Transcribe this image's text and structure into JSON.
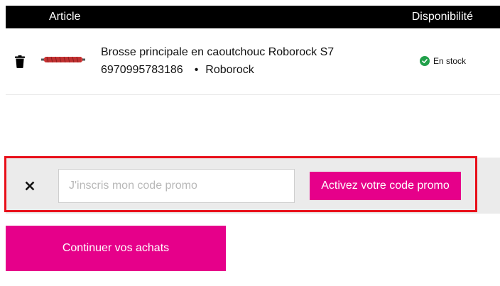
{
  "table_header": {
    "article_label": "Article",
    "availability_label": "Disponibilité"
  },
  "product": {
    "name": "Brosse principale en caoutchouc Roborock S7",
    "sku": "6970995783186",
    "brand": "Roborock",
    "stock_status": "En stock",
    "thumbnail_icon": "brush-thumbnail"
  },
  "icons": {
    "delete": "trash-icon",
    "stock": "check-circle-icon",
    "close": "close-icon"
  },
  "promo": {
    "placeholder": "J'inscris mon code promo",
    "value": "",
    "activate_label": "Activez votre code promo"
  },
  "continue_label": "Continuer vos achats",
  "colors": {
    "brand_pink": "#e6008a",
    "stock_green": "#21a04a",
    "highlight_red": "#e8101a",
    "header_black": "#000000"
  }
}
